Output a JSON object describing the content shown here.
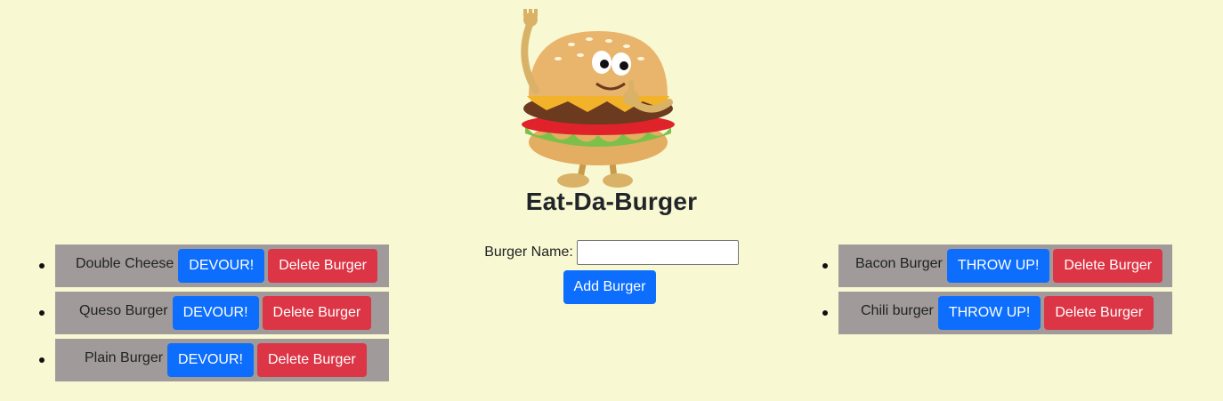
{
  "app": {
    "title": "Eat-Da-Burger"
  },
  "form": {
    "label": "Burger Name:",
    "input_value": "",
    "submit_label": "Add Burger"
  },
  "uneaten": [
    {
      "name": "Double Cheese",
      "action": "DEVOUR!",
      "delete": "Delete Burger"
    },
    {
      "name": "Queso Burger",
      "action": "DEVOUR!",
      "delete": "Delete Burger"
    },
    {
      "name": "Plain Burger",
      "action": "DEVOUR!",
      "delete": "Delete Burger"
    }
  ],
  "devoured": [
    {
      "name": "Bacon Burger",
      "action": "THROW UP!",
      "delete": "Delete Burger"
    },
    {
      "name": "Chili burger",
      "action": "THROW UP!",
      "delete": "Delete Burger"
    }
  ],
  "colors": {
    "background": "#f8f8d2",
    "row_bg": "#a09a9a",
    "primary": "#0d6efd",
    "danger": "#dc3545"
  },
  "logo": {
    "icon": "burger-mascot-icon"
  }
}
